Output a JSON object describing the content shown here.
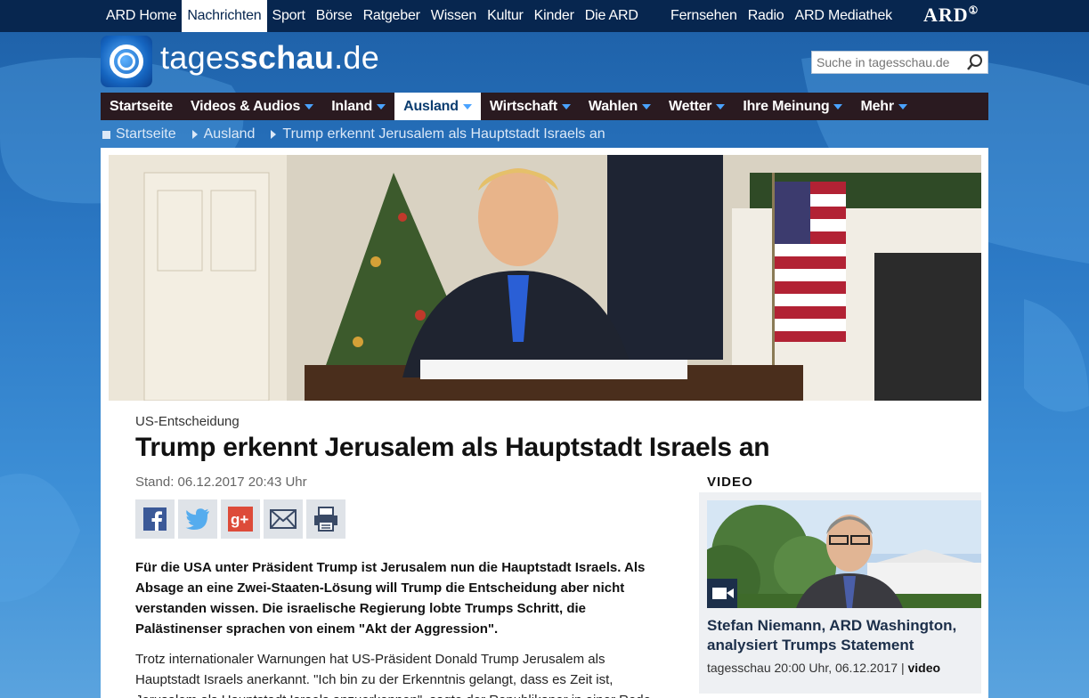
{
  "ard_bar": {
    "nav": [
      "ARD Home",
      "Nachrichten",
      "Sport",
      "Börse",
      "Ratgeber",
      "Wissen",
      "Kultur",
      "Kinder",
      "Die ARD"
    ],
    "active_index": 1,
    "right": [
      "Fernsehen",
      "Radio",
      "ARD Mediathek"
    ],
    "logo": "ARD",
    "logo_mark": "①"
  },
  "header": {
    "site_name_prefix": "tages",
    "site_name_bold": "schau",
    "site_name_suffix": ".de",
    "search_placeholder": "Suche in tagesschau.de"
  },
  "main_nav": {
    "items": [
      {
        "label": "Startseite",
        "has_menu": false
      },
      {
        "label": "Videos & Audios",
        "has_menu": true
      },
      {
        "label": "Inland",
        "has_menu": true
      },
      {
        "label": "Ausland",
        "has_menu": true,
        "active": true
      },
      {
        "label": "Wirtschaft",
        "has_menu": true
      },
      {
        "label": "Wahlen",
        "has_menu": true
      },
      {
        "label": "Wetter",
        "has_menu": true
      },
      {
        "label": "Ihre Meinung",
        "has_menu": true
      },
      {
        "label": "Mehr",
        "has_menu": true
      }
    ]
  },
  "breadcrumb": [
    "Startseite",
    "Ausland",
    "Trump erkennt Jerusalem als Hauptstadt Israels an"
  ],
  "article": {
    "topline": "US-Entscheidung",
    "headline": "Trump erkennt Jerusalem als Hauptstadt Israels an",
    "stand": "Stand: 06.12.2017 20:43 Uhr",
    "share_buttons": [
      "facebook-icon",
      "twitter-icon",
      "google-plus-icon",
      "mail-icon",
      "print-icon"
    ],
    "lead": "Für die USA unter Präsident Trump ist Jerusalem nun die Hauptstadt Israels. Als Absage an eine Zwei-Staaten-Lösung will Trump die Entscheidung aber nicht verstanden wissen. Die israelische Regierung lobte Trumps Schritt, die Palästinenser sprachen von einem \"Akt der Aggression\".",
    "body": "Trotz internationaler Warnungen hat US-Präsident Donald Trump Jerusalem als Hauptstadt Israels anerkannt. \"Ich bin zu der Erkenntnis gelangt, dass es Zeit ist, Jerusalem als Hauptstadt Israels anzuerkennen\", sagte der Republikaner in einer Rede"
  },
  "video": {
    "label": "VIDEO",
    "title": "Stefan Niemann, ARD Washington, analysiert Trumps Statement",
    "meta_source": "tagesschau 20:00 Uhr, 06.12.2017",
    "meta_separator": "|",
    "meta_type": "video"
  },
  "colors": {
    "ard_bar": "#07264f",
    "main_nav": "#2a1a20",
    "accent_caret": "#4aa3ff"
  }
}
